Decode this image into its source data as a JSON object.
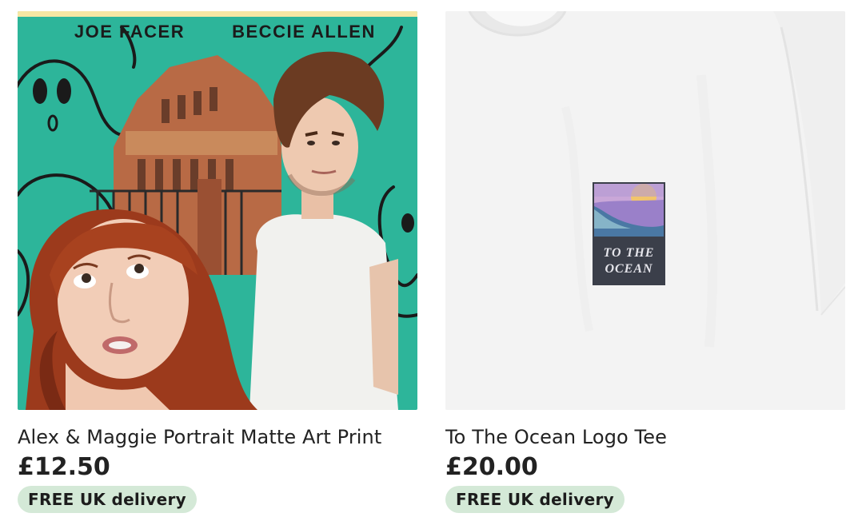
{
  "listings": [
    {
      "title": "Alex & Maggie Portrait Matte Art Print",
      "price": "£12.50",
      "badge": "FREE UK delivery",
      "image": {
        "names_left": "JOE FACER",
        "names_right": "BECCIE ALLEN",
        "background_color": "#2db59a"
      }
    },
    {
      "title": "To The Ocean Logo Tee",
      "price": "£20.00",
      "badge": "FREE UK delivery",
      "image": {
        "patch_line_1": "TO THE",
        "patch_line_2": "OCEAN",
        "shirt_color": "#f4f4f4"
      }
    }
  ],
  "colors": {
    "badge_bg": "#d4e9d7",
    "text": "#222222"
  }
}
